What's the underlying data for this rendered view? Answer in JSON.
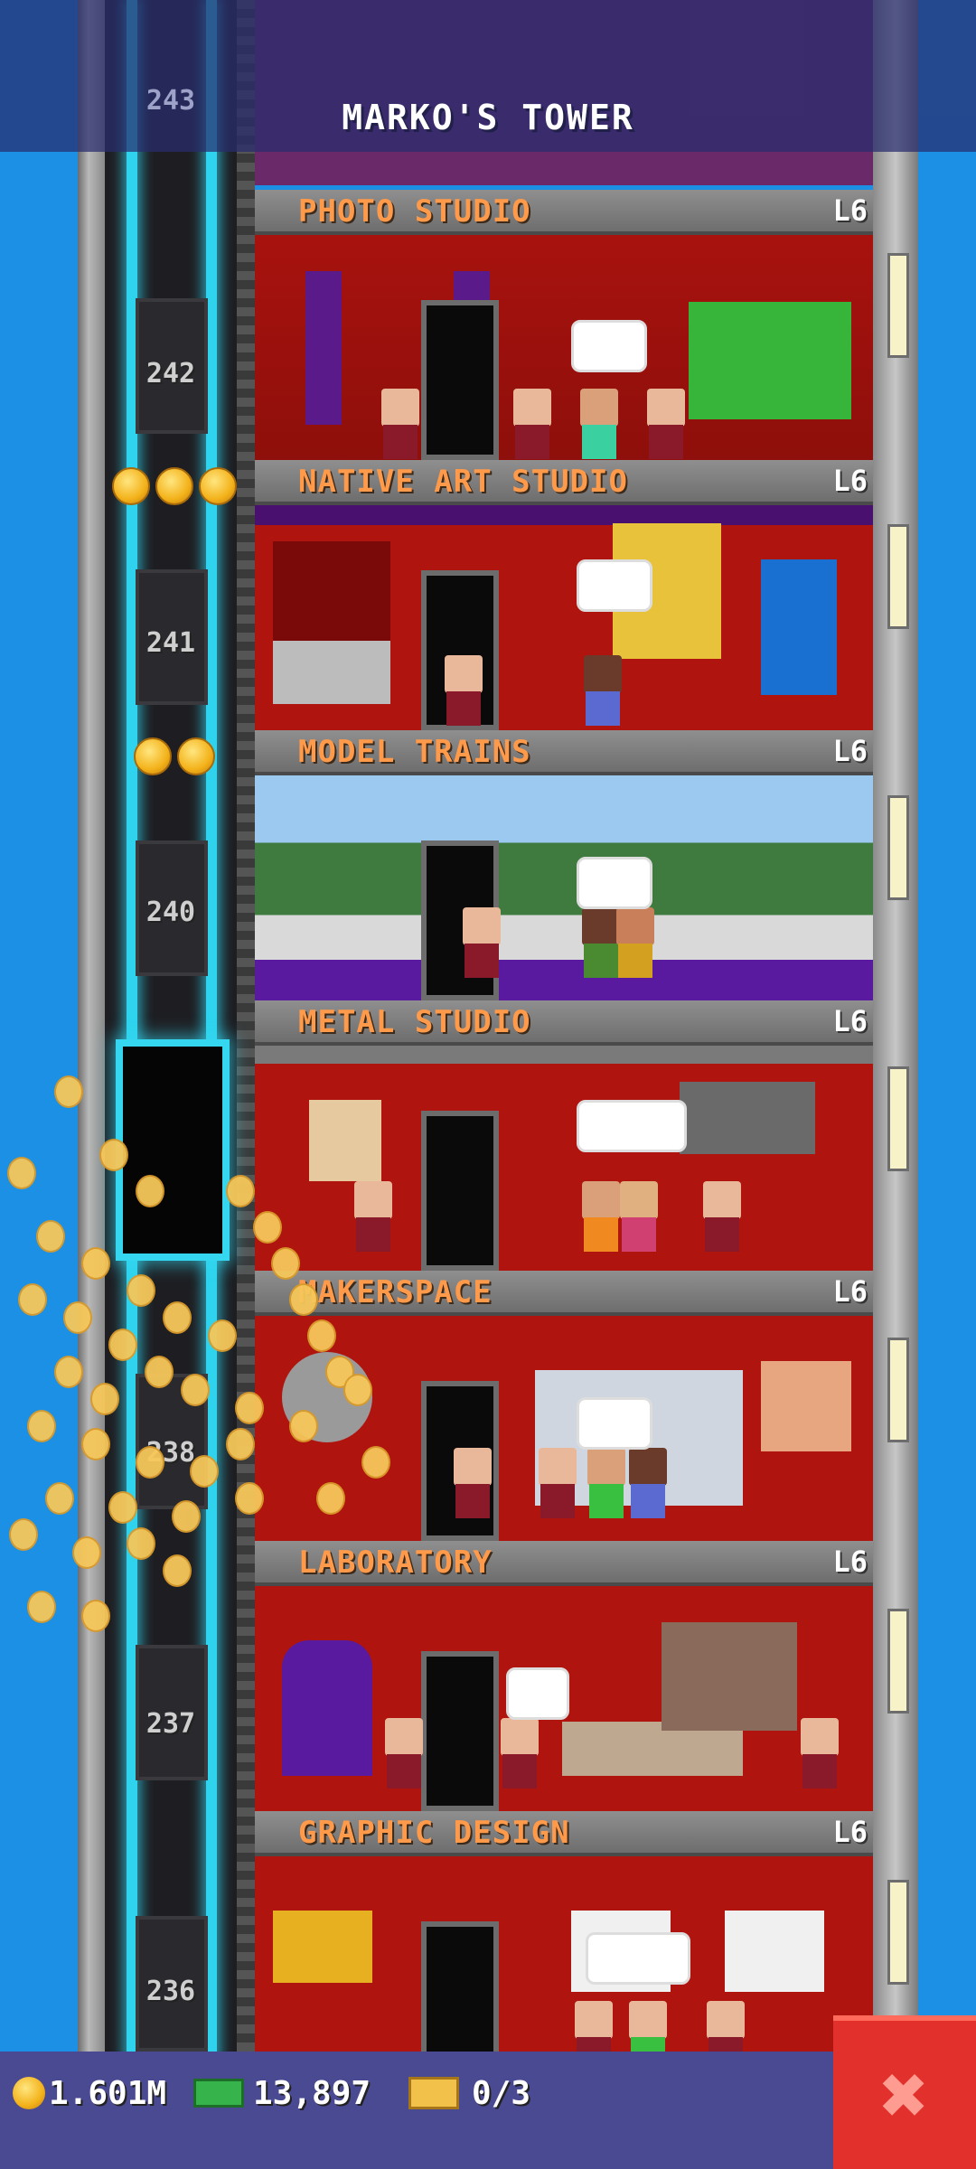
{
  "header": {
    "title": "MARKO'S TOWER",
    "top_floor_number": "243"
  },
  "floors": [
    {
      "name": "PHOTO STUDIO",
      "level": "L6",
      "shaft_number": "242"
    },
    {
      "name": "NATIVE ART STUDIO",
      "level": "L6",
      "shaft_number": "241"
    },
    {
      "name": "MODEL TRAINS",
      "level": "L6",
      "shaft_number": "240"
    },
    {
      "name": "METAL STUDIO",
      "level": "L6",
      "shaft_number": ""
    },
    {
      "name": "MAKERSPACE",
      "level": "L6",
      "shaft_number": "238"
    },
    {
      "name": "LABORATORY",
      "level": "L6",
      "shaft_number": "237"
    },
    {
      "name": "GRAPHIC DESIGN",
      "level": "L6",
      "shaft_number": "236"
    }
  ],
  "currency": {
    "coins": "1.601M",
    "bux": "13,897",
    "tickets": "0/3"
  },
  "icons": {
    "coin": "coin-icon",
    "bux": "bux-icon",
    "ticket": "ticket-icon",
    "close": "close-icon"
  },
  "close_label": "✖",
  "colors": {
    "sky": "#1b90e4",
    "room": "#b0140f",
    "floor_name": "#ff9a4a",
    "elevator_glow": "#34d6f0",
    "close_button": "#e2312c"
  }
}
